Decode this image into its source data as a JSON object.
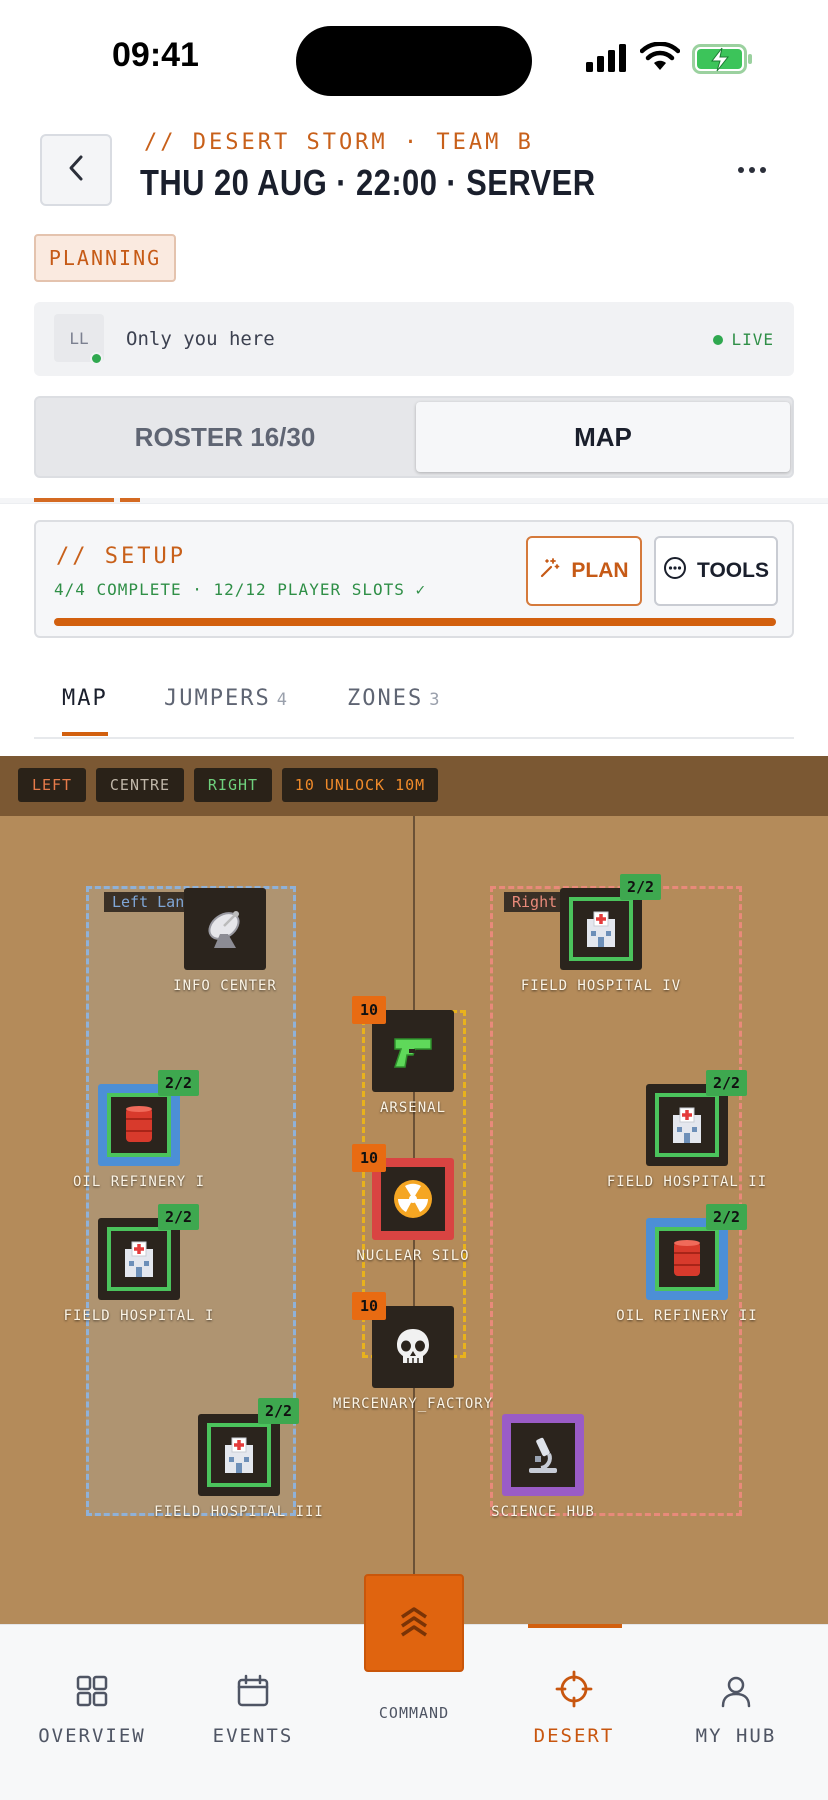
{
  "status_bar": {
    "time": "09:41"
  },
  "header": {
    "subtitle": "// DESERT STORM · TEAM B",
    "title": "THU 20 AUG · 22:00 · SERVER",
    "status_badge": "PLANNING"
  },
  "presence": {
    "avatar_initials": "LL",
    "text": "Only you here",
    "live_label": "LIVE"
  },
  "segments": {
    "roster": "ROSTER 16/30",
    "map": "MAP",
    "active": "MAP"
  },
  "setup": {
    "title": "// SETUP",
    "subtitle": "4/4 COMPLETE · 12/12 PLAYER SLOTS ✓",
    "plan_label": "PLAN",
    "tools_label": "TOOLS",
    "progress": 1.0
  },
  "subtabs": [
    {
      "label": "MAP",
      "count": ""
    },
    {
      "label": "JUMPERS",
      "count": "4"
    },
    {
      "label": "ZONES",
      "count": "3"
    }
  ],
  "map": {
    "filters": {
      "left": "LEFT",
      "centre": "CENTRE",
      "right": "RIGHT",
      "unlock": "10 UNLOCK 10M"
    },
    "lanes": {
      "left": "Left Lane",
      "right": "Right"
    },
    "buildings": {
      "info_center": {
        "label": "INFO CENTER",
        "icon": "satellite-dish-icon"
      },
      "field_hospital_iv": {
        "label": "FIELD HOSPITAL IV",
        "capacity": "2/2",
        "icon": "hospital-icon"
      },
      "arsenal": {
        "label": "ARSENAL",
        "level": "10",
        "icon": "pistol-icon"
      },
      "oil_refinery_i": {
        "label": "OIL REFINERY I",
        "capacity": "2/2",
        "icon": "oil-drum-icon"
      },
      "field_hospital_ii": {
        "label": "FIELD HOSPITAL II",
        "capacity": "2/2",
        "icon": "hospital-icon"
      },
      "nuclear_silo": {
        "label": "NUCLEAR SILO",
        "level": "10",
        "icon": "radioactive-icon"
      },
      "field_hospital_i": {
        "label": "FIELD HOSPITAL I",
        "capacity": "2/2",
        "icon": "hospital-icon"
      },
      "oil_refinery_ii": {
        "label": "OIL REFINERY II",
        "capacity": "2/2",
        "icon": "oil-drum-icon"
      },
      "mercenary_factory": {
        "label": "MERCENARY_FACTORY",
        "level": "10",
        "icon": "skull-icon"
      },
      "field_hospital_iii": {
        "label": "FIELD HOSPITAL III",
        "capacity": "2/2",
        "icon": "hospital-icon"
      },
      "science_hub": {
        "label": "SCIENCE HUB",
        "icon": "microscope-icon"
      }
    }
  },
  "nav": {
    "overview": "OVERVIEW",
    "events": "EVENTS",
    "command": "COMMAND",
    "desert": "DESERT",
    "my_hub": "MY HUB",
    "active": "DESERT"
  },
  "colors": {
    "accent": "#d2600f",
    "map_bg": "#b48b5a",
    "left_lane": "#8fb1d8",
    "right_lane": "#e88a7a",
    "centre_lane": "#e8b21c",
    "success": "#3ea84f"
  }
}
